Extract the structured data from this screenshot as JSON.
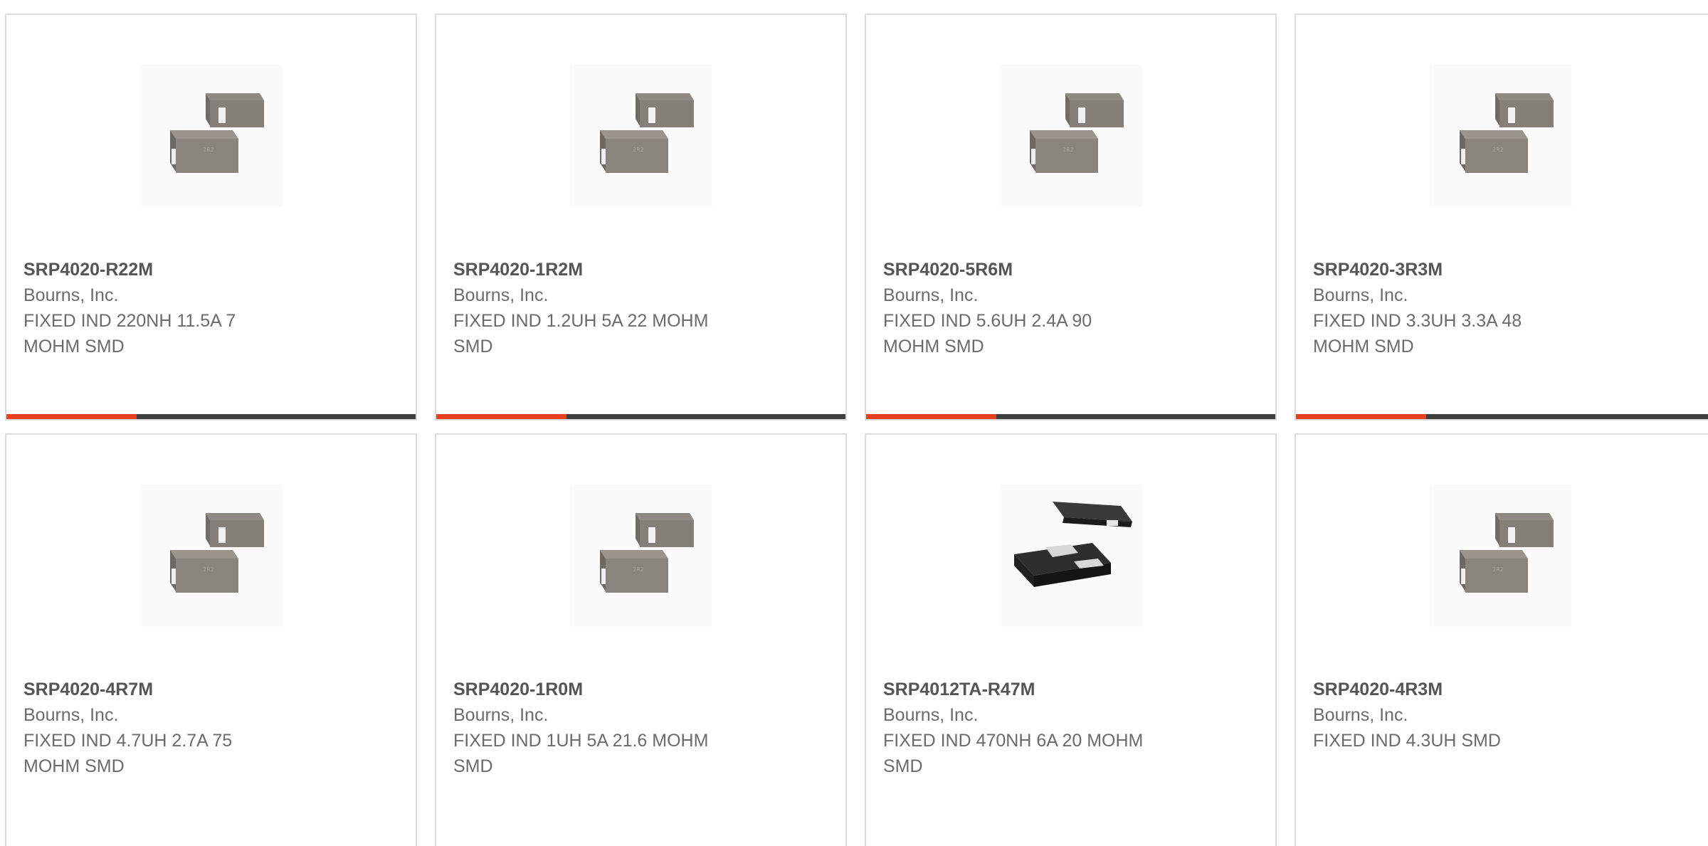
{
  "products": [
    {
      "part_number": "SRP4020-R22M",
      "manufacturer": "Bourns, Inc.",
      "description_line1": "FIXED IND 220NH 11.5A 7",
      "description_line2": "MOHM SMD",
      "image_icon": "gray-smd-inductor-icon"
    },
    {
      "part_number": "SRP4020-1R2M",
      "manufacturer": "Bourns, Inc.",
      "description_line1": "FIXED IND 1.2UH 5A 22 MOHM",
      "description_line2": "SMD",
      "image_icon": "gray-smd-inductor-icon"
    },
    {
      "part_number": "SRP4020-5R6M",
      "manufacturer": "Bourns, Inc.",
      "description_line1": "FIXED IND 5.6UH 2.4A 90",
      "description_line2": "MOHM SMD",
      "image_icon": "gray-smd-inductor-icon"
    },
    {
      "part_number": "SRP4020-3R3M",
      "manufacturer": "Bourns, Inc.",
      "description_line1": "FIXED IND 3.3UH 3.3A 48",
      "description_line2": "MOHM SMD",
      "image_icon": "gray-smd-inductor-icon"
    },
    {
      "part_number": "SRP4020-4R7M",
      "manufacturer": "Bourns, Inc.",
      "description_line1": "FIXED IND 4.7UH 2.7A 75",
      "description_line2": "MOHM SMD",
      "image_icon": "gray-smd-inductor-icon"
    },
    {
      "part_number": "SRP4020-1R0M",
      "manufacturer": "Bourns, Inc.",
      "description_line1": "FIXED IND 1UH 5A 21.6 MOHM",
      "description_line2": "SMD",
      "image_icon": "gray-smd-inductor-icon"
    },
    {
      "part_number": "SRP4012TA-R47M",
      "manufacturer": "Bourns, Inc.",
      "description_line1": "FIXED IND 470NH 6A 20 MOHM",
      "description_line2": "SMD",
      "image_icon": "black-smd-inductor-icon"
    },
    {
      "part_number": "SRP4020-4R3M",
      "manufacturer": "Bourns, Inc.",
      "description_line1": "FIXED IND 4.3UH SMD",
      "description_line2": "",
      "image_icon": "gray-smd-inductor-icon"
    }
  ],
  "colors": {
    "accent": "#e8401c",
    "bar_track": "#3e3e3e",
    "card_border": "#dcdcdc",
    "part_text": "#555555",
    "body_text": "#6b6b6b"
  }
}
